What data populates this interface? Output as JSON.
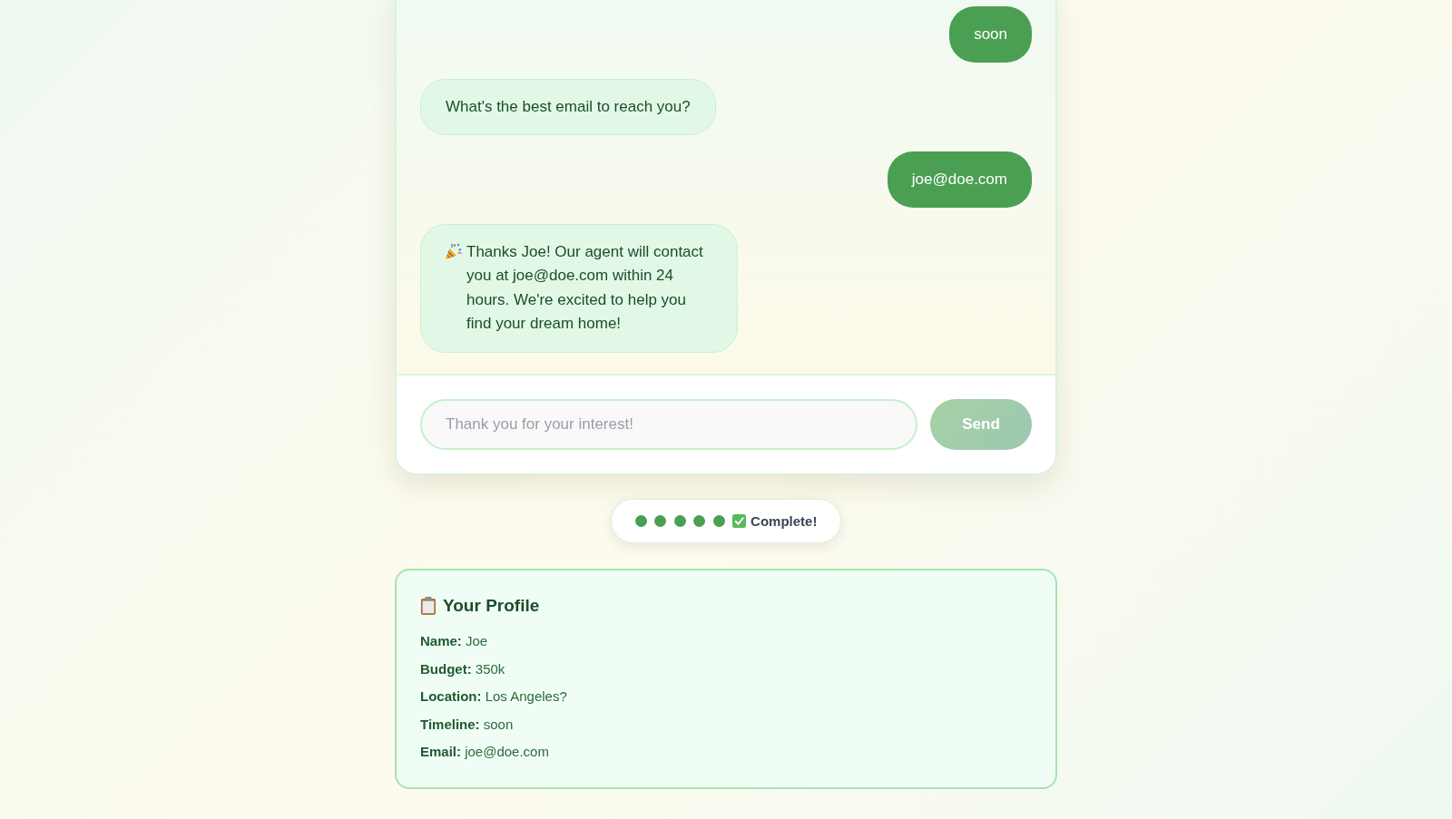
{
  "chat": {
    "messages": [
      {
        "outgoing": true,
        "kind": "plain",
        "text": "soon"
      },
      {
        "outgoing": false,
        "kind": "plain",
        "text": "What's the best email to reach you?"
      },
      {
        "outgoing": true,
        "kind": "plain",
        "text": "joe@doe.com"
      },
      {
        "outgoing": false,
        "kind": "celebration",
        "text": "Thanks Joe! Our agent will contact you at joe@doe.com within 24 hours. We're excited to help you find your dream home!"
      }
    ]
  },
  "composer": {
    "placeholder": "Thank you for your interest!",
    "send": {
      "label": "Send",
      "disabled": true
    }
  },
  "progress": {
    "steps": [
      {
        "done": true
      },
      {
        "done": true
      },
      {
        "done": true
      },
      {
        "done": true
      },
      {
        "done": true
      }
    ],
    "complete": true,
    "label": "Complete!"
  },
  "profile": {
    "title": "Your Profile",
    "fields": [
      "**Name:** Joe",
      "**Budget:** 350k",
      "**Location:** Los Angeles?",
      "**Timeline:** soon",
      "**Email:** joe@doe.com"
    ]
  }
}
